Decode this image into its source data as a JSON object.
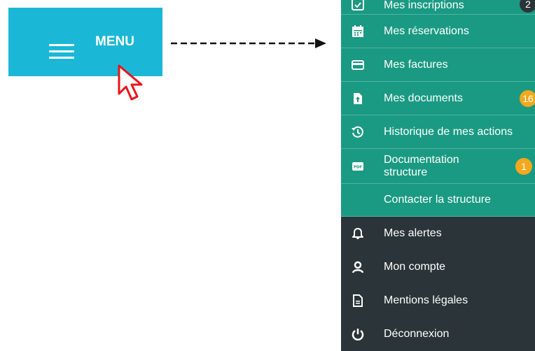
{
  "menu_button": {
    "label": "MENU"
  },
  "menu_items": [
    {
      "label": "Mes inscriptions",
      "icon": "calendar-check-icon",
      "badge": "2"
    },
    {
      "label": "Mes réservations",
      "icon": "calendar-icon"
    },
    {
      "label": "Mes factures",
      "icon": "credit-card-icon"
    },
    {
      "label": "Mes documents",
      "icon": "file-upload-icon",
      "badge": "16"
    },
    {
      "label": "Historique de mes actions",
      "icon": "history-icon"
    },
    {
      "label": "Documentation structure",
      "icon": "pdf-icon",
      "badge": "1"
    },
    {
      "label": "Contacter la structure"
    },
    {
      "label": "Mes alertes",
      "icon": "bell-icon"
    },
    {
      "label": "Mon compte",
      "icon": "user-icon"
    },
    {
      "label": "Mentions légales",
      "icon": "document-icon"
    },
    {
      "label": "Déconnexion",
      "icon": "power-icon"
    }
  ],
  "colors": {
    "menu_button": "#1ab8d6",
    "teal_section": "#1a9a82",
    "dark_section": "#2b3438",
    "badge": "#f4a81d",
    "cursor": "#e8141b"
  }
}
